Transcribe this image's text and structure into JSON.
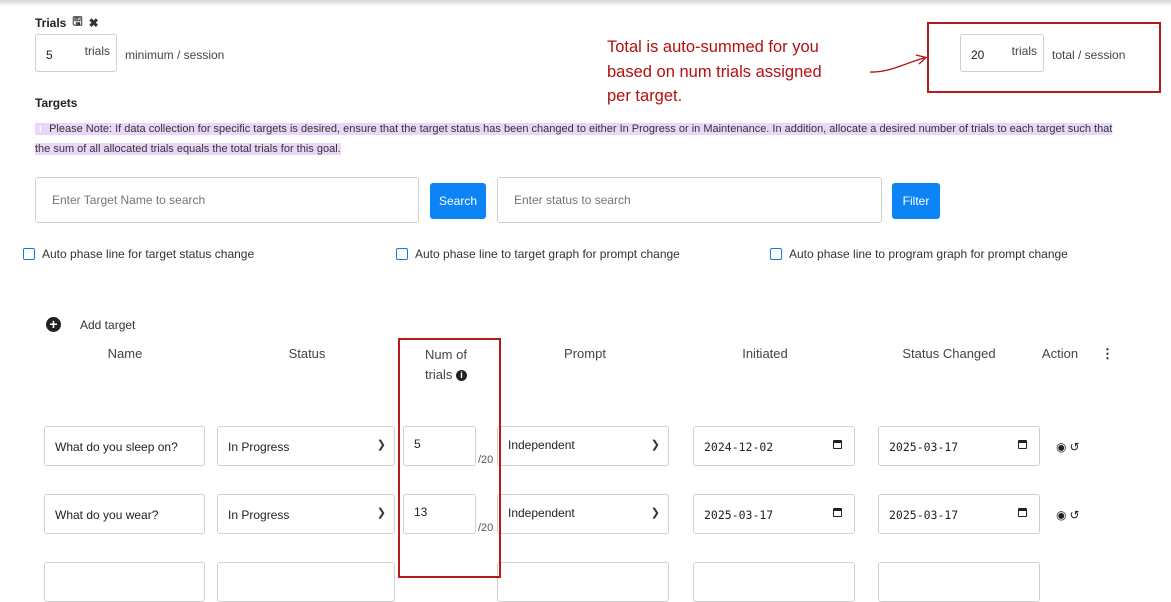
{
  "trials": {
    "title": "Trials",
    "minimum_value": "5",
    "minimum_unit": "trials",
    "minimum_label": "minimum / session",
    "total_value": "20",
    "total_unit": "trials",
    "total_label": "total / session"
  },
  "annotation": {
    "line1": "Total is auto-summed for you",
    "line2": "based on num trials assigned",
    "line3": "per target.",
    "color": "#b40f0f"
  },
  "targets": {
    "heading": "Targets",
    "note": "Please Note: If data collection for specific targets is desired, ensure that the target status has been changed to either In Progress or in Maintenance. In addition, allocate a desired number of trials to each target such that the sum of all allocated trials equals the total trials for this goal."
  },
  "search": {
    "name_placeholder": "Enter Target Name to search",
    "search_button": "Search",
    "status_placeholder": "Enter status to search",
    "filter_button": "Filter",
    "button_color": "#0d84f5"
  },
  "checkboxes": [
    "Auto phase line for target status change",
    "Auto phase line to target graph for prompt change",
    "Auto phase line to program graph for prompt change"
  ],
  "add_target": "Add target",
  "columns": {
    "name": "Name",
    "status": "Status",
    "num_trials_1": "Num of",
    "num_trials_2": "trials",
    "prompt": "Prompt",
    "initiated": "Initiated",
    "status_changed": "Status Changed",
    "action": "Action"
  },
  "rows": [
    {
      "name": "What do you sleep on?",
      "status": "In Progress",
      "trials": "5",
      "of_total": "/20",
      "prompt": "Independent",
      "initiated": "2024-12-02",
      "status_changed": "2025-03-17"
    },
    {
      "name": "What do you wear?",
      "status": "In Progress",
      "trials": "13",
      "of_total": "/20",
      "prompt": "Independent",
      "initiated": "2025-03-17",
      "status_changed": "2025-03-17"
    }
  ],
  "icons": [
    "save-icon",
    "close-icon",
    "info-icon",
    "plus-circle-icon",
    "chevron-down-icon",
    "calendar-icon",
    "eye-icon",
    "history-icon",
    "kebab-menu-icon"
  ]
}
